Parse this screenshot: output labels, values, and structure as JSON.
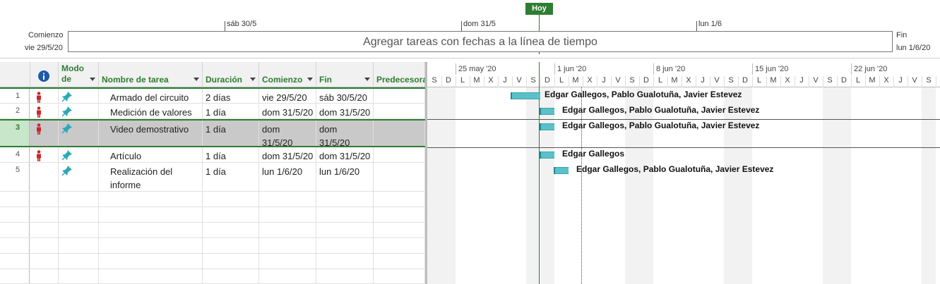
{
  "timeline": {
    "today_label": "Hoy",
    "ticks": [
      "sáb 30/5",
      "dom 31/5",
      "lun 1/6"
    ],
    "start_caption": "Comienzo",
    "start_date": "vie 29/5/20",
    "end_caption": "Fin",
    "end_date": "lun 1/6/20",
    "placeholder": "Agregar tareas con fechas a la línea de tiempo"
  },
  "grid": {
    "headers": {
      "mode": "Modo de",
      "name": "Nombre de tarea",
      "duration": "Duración",
      "start": "Comienzo",
      "finish": "Fin",
      "predecessors": "Predecesora"
    },
    "rows": [
      {
        "num": "1",
        "name": "Armado del circuito",
        "duration": "2 días",
        "start": "vie 29/5/20",
        "finish": "sáb 30/5/20",
        "resources": "Edgar Gallegos, Pablo Gualotuña, Javier Estevez"
      },
      {
        "num": "2",
        "name": "Medición de valores",
        "duration": "1 día",
        "start": "dom 31/5/20",
        "finish": "dom 31/5/20",
        "resources": "Edgar Gallegos, Pablo Gualotuña, Javier Estevez"
      },
      {
        "num": "3",
        "name": "Video demostrativo",
        "duration": "1 día",
        "start": "dom 31/5/20",
        "finish": "dom 31/5/20",
        "resources": "Edgar Gallegos, Pablo Gualotuña, Javier Estevez"
      },
      {
        "num": "4",
        "name": "Artículo",
        "duration": "1 día",
        "start": "dom 31/5/20",
        "finish": "dom 31/5/20",
        "resources": "Edgar Gallegos"
      },
      {
        "num": "5",
        "name": "Realización del informe",
        "duration": "1 día",
        "start": "lun 1/6/20",
        "finish": "lun 1/6/20",
        "resources": "Edgar Gallegos, Pablo Gualotuña, Javier Estevez"
      }
    ]
  },
  "gantt": {
    "weeks": [
      "25 may '20",
      "1 jun '20",
      "8 jun '20",
      "15 jun '20",
      "22 jun '20"
    ],
    "days": [
      "S",
      "D",
      "L",
      "M",
      "X",
      "J",
      "V",
      "S",
      "D",
      "L",
      "M",
      "X",
      "J",
      "V",
      "S",
      "D",
      "L",
      "M",
      "X",
      "J",
      "V",
      "S",
      "D",
      "L",
      "M",
      "X",
      "J",
      "V",
      "S",
      "D",
      "L",
      "M",
      "X",
      "J",
      "V",
      "S"
    ]
  },
  "colors": {
    "accent": "#2e7d32",
    "bar": "#5bc0c8",
    "person_icon": "#c62828",
    "pin_icon": "#2aa9b8"
  }
}
